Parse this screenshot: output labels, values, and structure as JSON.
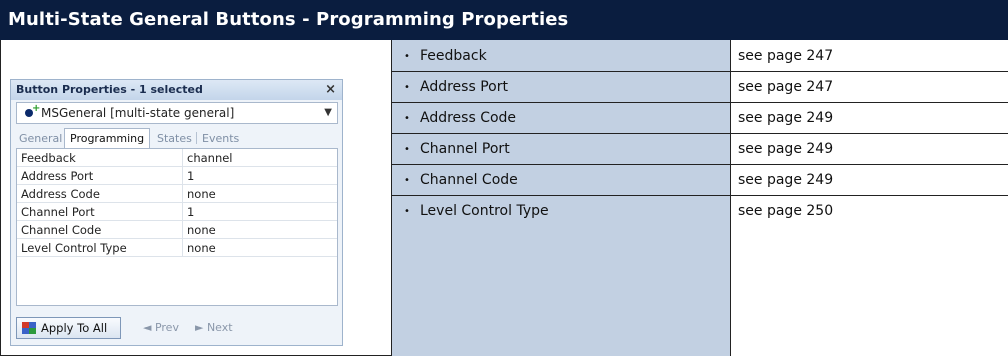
{
  "title": "Multi-State General Buttons - Programming Properties",
  "panel": {
    "header": "Button Properties - 1 selected",
    "close_glyph": "×",
    "selector": "MSGeneral  [multi-state general]",
    "tabs": [
      "General",
      "Programming",
      "States",
      "Events"
    ],
    "active_tab": "Programming",
    "rows": [
      {
        "name": "Feedback",
        "value": "channel"
      },
      {
        "name": "Address Port",
        "value": "1"
      },
      {
        "name": "Address Code",
        "value": "none"
      },
      {
        "name": "Channel Port",
        "value": "1"
      },
      {
        "name": "Channel Code",
        "value": "none"
      },
      {
        "name": "Level Control Type",
        "value": "none"
      }
    ],
    "apply_label": "Apply To All",
    "prev_label": "◄  Prev",
    "next_label": "►  Next"
  },
  "table": {
    "bullet": "•",
    "rows": [
      {
        "property": "Feedback",
        "page": "see page 247"
      },
      {
        "property": "Address Port",
        "page": "see page 247"
      },
      {
        "property": "Address Code",
        "page": "see page 249"
      },
      {
        "property": "Channel Port",
        "page": "see page 249"
      },
      {
        "property": "Channel Code",
        "page": "see page 249"
      },
      {
        "property": "Level Control Type",
        "page": "see page 250"
      }
    ]
  },
  "colors": {
    "title_background": "#0a1d3f",
    "property_column_background": "#c2d0e2"
  }
}
